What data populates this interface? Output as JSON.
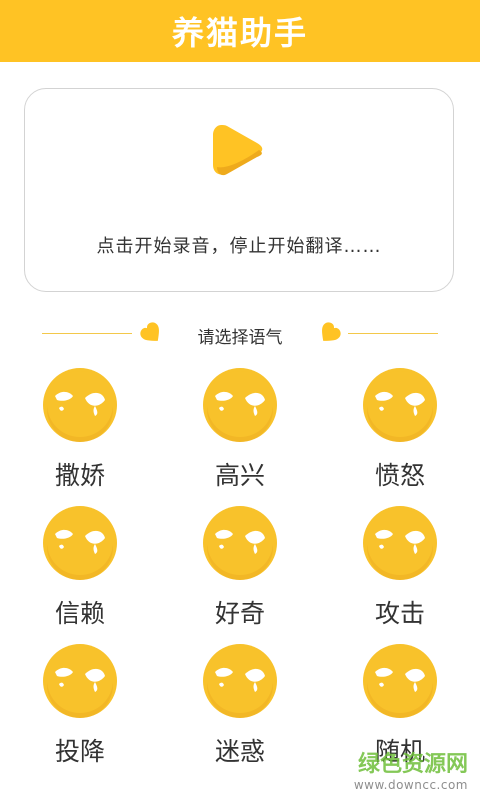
{
  "header": {
    "title": "养猫助手",
    "color": "#ffc324"
  },
  "record_card": {
    "play_icon": "play-icon",
    "hint": "点击开始录音，停止开始翻译……"
  },
  "mood_section": {
    "label": "请选择语气",
    "moods": [
      {
        "label": "撒娇",
        "icon": "cat-face-icon"
      },
      {
        "label": "高兴",
        "icon": "cat-face-icon"
      },
      {
        "label": "愤怒",
        "icon": "cat-face-icon"
      },
      {
        "label": "信赖",
        "icon": "cat-face-icon"
      },
      {
        "label": "好奇",
        "icon": "cat-face-icon"
      },
      {
        "label": "攻击",
        "icon": "cat-face-icon"
      },
      {
        "label": "投降",
        "icon": "cat-face-icon"
      },
      {
        "label": "迷惑",
        "icon": "cat-face-icon"
      },
      {
        "label": "随机",
        "icon": "cat-face-icon"
      }
    ]
  },
  "watermark": {
    "main": "绿色资源网",
    "sub": "www.downcc.com"
  },
  "colors": {
    "accent": "#ffc324",
    "icon_yellow": "#f8c22b",
    "icon_dark": "#e9a41c",
    "text": "#333333"
  }
}
